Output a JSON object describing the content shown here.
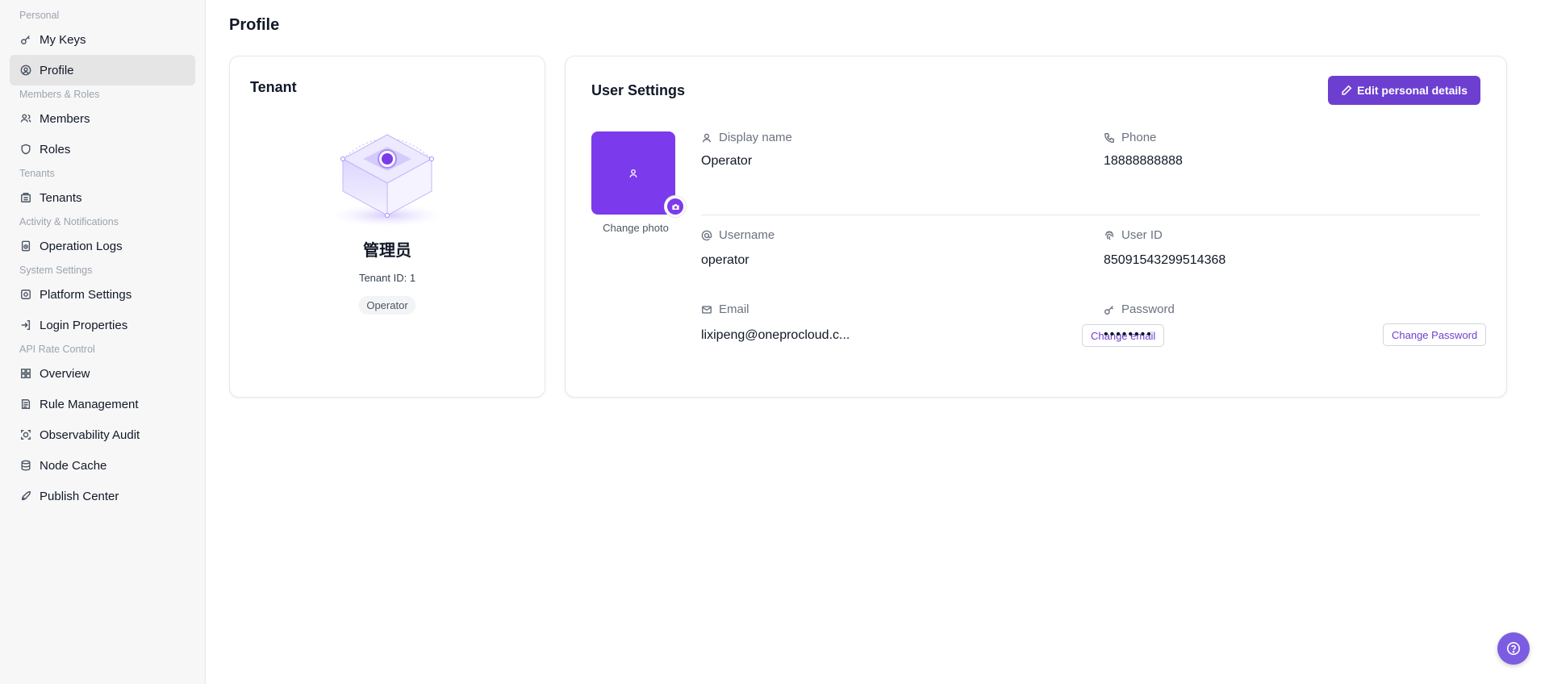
{
  "sidebar": {
    "sections": [
      {
        "label": "Personal",
        "items": [
          {
            "label": "My Keys",
            "icon": "key-icon"
          },
          {
            "label": "Profile",
            "icon": "user-circle-icon",
            "active": true
          }
        ]
      },
      {
        "label": "Members & Roles",
        "items": [
          {
            "label": "Members",
            "icon": "users-icon"
          },
          {
            "label": "Roles",
            "icon": "shield-icon"
          }
        ]
      },
      {
        "label": "Tenants",
        "items": [
          {
            "label": "Tenants",
            "icon": "building-icon"
          }
        ]
      },
      {
        "label": "Activity & Notifications",
        "items": [
          {
            "label": "Operation Logs",
            "icon": "logs-icon"
          }
        ]
      },
      {
        "label": "System Settings",
        "items": [
          {
            "label": "Platform Settings",
            "icon": "settings-icon"
          },
          {
            "label": "Login Properties",
            "icon": "login-icon"
          }
        ]
      },
      {
        "label": "API Rate Control",
        "items": [
          {
            "label": "Overview",
            "icon": "grid-icon"
          },
          {
            "label": "Rule Management",
            "icon": "rules-icon"
          },
          {
            "label": "Observability Audit",
            "icon": "audit-icon"
          },
          {
            "label": "Node Cache",
            "icon": "database-icon"
          },
          {
            "label": "Publish Center",
            "icon": "rocket-icon"
          }
        ]
      }
    ]
  },
  "page": {
    "title": "Profile"
  },
  "tenant": {
    "title": "Tenant",
    "name": "管理员",
    "id_label": "Tenant ID:",
    "id_value": "1",
    "role_badge": "Operator"
  },
  "user": {
    "title": "User Settings",
    "edit_button": "Edit personal details",
    "change_photo": "Change photo",
    "display_name_label": "Display name",
    "display_name": "Operator",
    "phone_label": "Phone",
    "phone": "18888888888",
    "username_label": "Username",
    "username": "operator",
    "user_id_label": "User ID",
    "user_id": "85091543299514368",
    "email_label": "Email",
    "email": "lixipeng@oneprocloud.c...",
    "change_email": "Change email",
    "password_label": "Password",
    "password_masked": "••••••••",
    "change_password": "Change Password"
  },
  "colors": {
    "accent": "#6d3fd0",
    "avatar": "#7c3aed"
  }
}
